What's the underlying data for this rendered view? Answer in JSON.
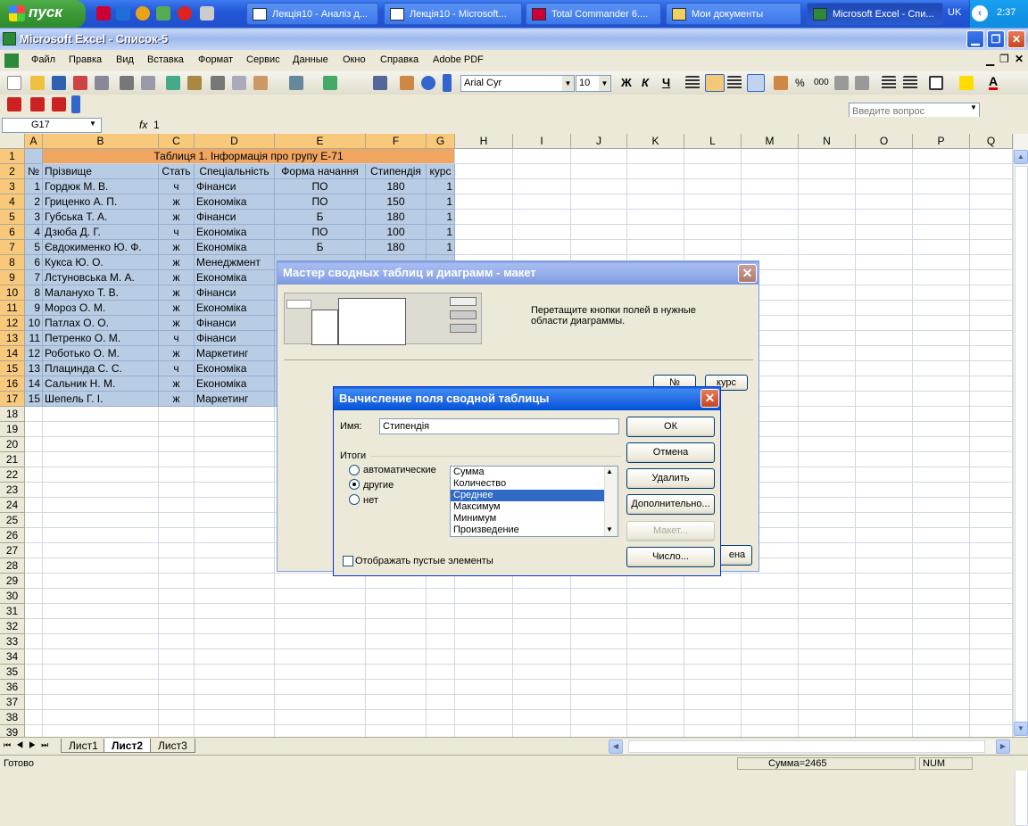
{
  "taskbar": {
    "start_label": "пуск",
    "buttons": [
      {
        "label": "Лекція10 - Аналіз д..."
      },
      {
        "label": "Лекція10 - Microsoft..."
      },
      {
        "label": "Total Commander 6...."
      },
      {
        "label": "Мои документы"
      },
      {
        "label": "Microsoft Excel - Спи..."
      }
    ],
    "lang": "UK",
    "clock": "2:37"
  },
  "window": {
    "title": "Microsoft Excel - Список-5"
  },
  "menu": [
    "Файл",
    "Правка",
    "Вид",
    "Вставка",
    "Формат",
    "Сервис",
    "Данные",
    "Окно",
    "Справка",
    "Adobe PDF"
  ],
  "ask_placeholder": "Введите вопрос",
  "format_toolbar": {
    "font": "Arial Cyr",
    "size": "10",
    "bold": "Ж",
    "italic": "К",
    "underline": "Ч",
    "percent": "%",
    "thousands": "000"
  },
  "formula_bar": {
    "cell_ref": "G17",
    "fx": "fx",
    "value": "1"
  },
  "columns": [
    "A",
    "B",
    "C",
    "D",
    "E",
    "F",
    "G",
    "H",
    "I",
    "J",
    "K",
    "L",
    "M",
    "N",
    "O",
    "P",
    "Q"
  ],
  "sheet": {
    "title": "Таблиця 1. Інформація про групу Е-71",
    "headers": [
      "№",
      "Прізвище",
      "Стать",
      "Спеціальність",
      "Форма начання",
      "Стипендія",
      "курс"
    ],
    "rows": [
      [
        "1",
        "Гордюк М. В.",
        "ч",
        "Фінанси",
        "ПО",
        "180",
        "1"
      ],
      [
        "2",
        "Гриценко А. П.",
        "ж",
        "Економіка",
        "ПО",
        "150",
        "1"
      ],
      [
        "3",
        "Губська Т. А.",
        "ж",
        "Фінанси",
        "Б",
        "180",
        "1"
      ],
      [
        "4",
        "Дзюба Д. Г.",
        "ч",
        "Економіка",
        "ПО",
        "100",
        "1"
      ],
      [
        "5",
        "Євдокименко Ю. Ф.",
        "ж",
        "Економіка",
        "Б",
        "180",
        "1"
      ],
      [
        "6",
        "Кукса Ю. О.",
        "ж",
        "Менеджмент",
        "",
        "",
        ""
      ],
      [
        "7",
        "Лстуновська М. А.",
        "ж",
        "Економіка",
        "",
        "",
        ""
      ],
      [
        "8",
        "Маланухо Т. В.",
        "ж",
        "Фінанси",
        "",
        "",
        ""
      ],
      [
        "9",
        "Мороз О. М.",
        "ж",
        "Економіка",
        "",
        "",
        ""
      ],
      [
        "10",
        "Патлах О. О.",
        "ж",
        "Фінанси",
        "",
        "",
        ""
      ],
      [
        "11",
        "Петренко О. М.",
        "ч",
        "Фінанси",
        "",
        "",
        ""
      ],
      [
        "12",
        "Роботько О. М.",
        "ж",
        "Маркетинг",
        "",
        "",
        ""
      ],
      [
        "13",
        "Плацинда С. С.",
        "ч",
        "Економіка",
        "",
        "",
        ""
      ],
      [
        "14",
        "Сальник Н. М.",
        "ж",
        "Економіка",
        "",
        "",
        ""
      ],
      [
        "15",
        "Шепель Г. І.",
        "ж",
        "Маркетинг",
        "",
        "",
        ""
      ]
    ],
    "row_numbers": [
      "1",
      "2",
      "3",
      "4",
      "5",
      "6",
      "7",
      "8",
      "9",
      "10",
      "11",
      "12",
      "13",
      "14",
      "15",
      "16",
      "17",
      "18",
      "19",
      "20",
      "21",
      "22",
      "23",
      "24",
      "25",
      "26",
      "27",
      "28",
      "29",
      "30",
      "31",
      "32",
      "33",
      "34",
      "35",
      "36",
      "37",
      "38",
      "39"
    ]
  },
  "sheet_tabs": [
    "Лист1",
    "Лист2",
    "Лист3"
  ],
  "status": {
    "left": "Готово",
    "sum": "Сумма=2465",
    "num": "NUM"
  },
  "wizard": {
    "title": "Мастер сводных таблиц и диаграмм - макет",
    "hint": "Перетащите кнопки полей в нужные области диаграммы.",
    "field_buttons": [
      "№",
      "курс"
    ],
    "partial_button": "ена"
  },
  "calc_dialog": {
    "title": "Вычисление поля сводной таблицы",
    "name_label": "Имя:",
    "name_value": "Стипендія",
    "totals_label": "Итоги",
    "radios": [
      {
        "label": "автоматические",
        "checked": false
      },
      {
        "label": "другие",
        "checked": true
      },
      {
        "label": "нет",
        "checked": false
      }
    ],
    "functions": [
      "Сумма",
      "Количество",
      "Среднее",
      "Максимум",
      "Минимум",
      "Произведение"
    ],
    "selected_function": "Среднее",
    "show_empty_label": "Отображать пустые элементы",
    "buttons": {
      "ok": "ОК",
      "cancel": "Отмена",
      "delete": "Удалить",
      "more": "Дополнительно...",
      "layout": "Макет...",
      "number": "Число..."
    }
  }
}
